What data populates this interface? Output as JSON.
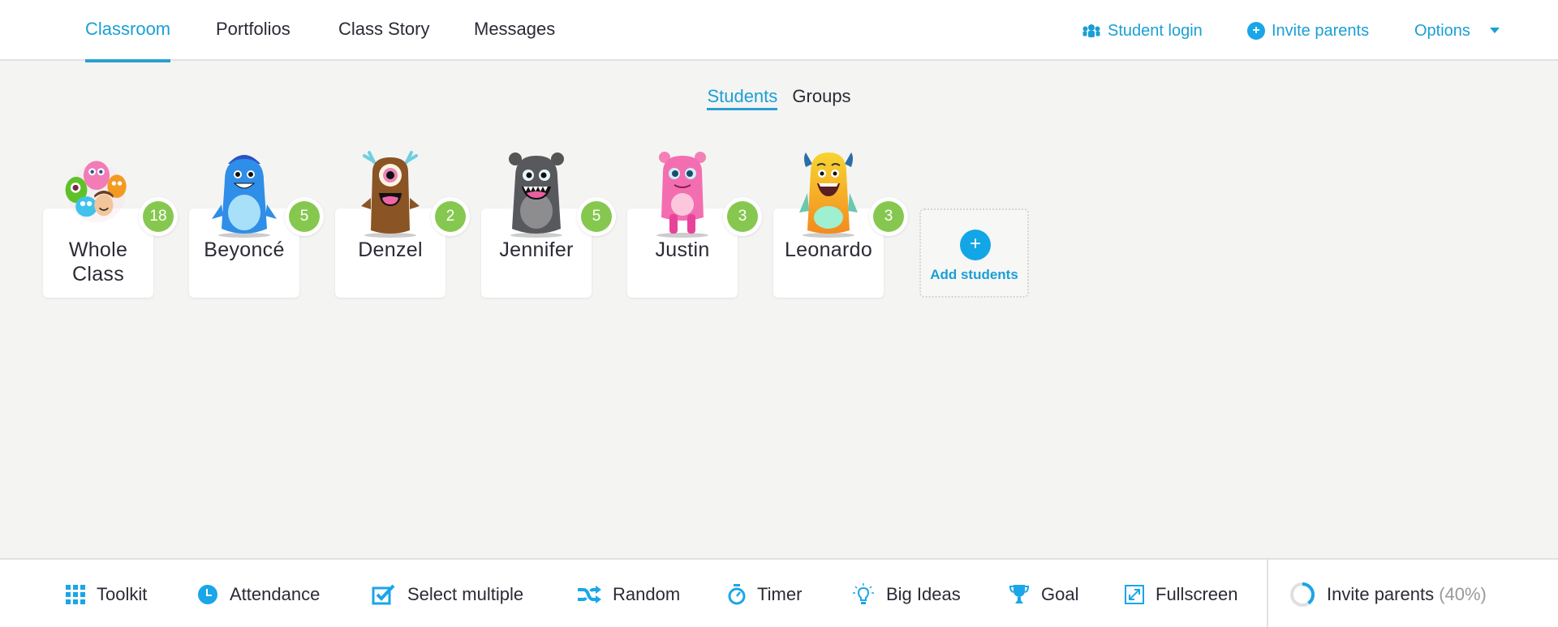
{
  "header": {
    "tabs": [
      {
        "label": "Classroom",
        "active": true
      },
      {
        "label": "Portfolios",
        "active": false
      },
      {
        "label": "Class Story",
        "active": false
      },
      {
        "label": "Messages",
        "active": false
      }
    ],
    "student_login": "Student login",
    "invite_parents": "Invite parents",
    "options": "Options"
  },
  "subtabs": {
    "students": "Students",
    "groups": "Groups",
    "active": "students"
  },
  "students": [
    {
      "name_line1": "Whole",
      "name_line2": "Class",
      "points": "18",
      "avatar": "whole-class-monsters"
    },
    {
      "name_line1": "Beyoncé",
      "points": "5",
      "avatar": "blue-monster"
    },
    {
      "name_line1": "Denzel",
      "points": "2",
      "avatar": "brown-cyclops-monster"
    },
    {
      "name_line1": "Jennifer",
      "points": "5",
      "avatar": "gray-monster"
    },
    {
      "name_line1": "Justin",
      "points": "3",
      "avatar": "pink-monster"
    },
    {
      "name_line1": "Leonardo",
      "points": "3",
      "avatar": "yellow-monster"
    }
  ],
  "add_students": {
    "icon": "+",
    "label": "Add students"
  },
  "toolbar": {
    "items": [
      {
        "label": "Toolkit",
        "icon": "grid-icon"
      },
      {
        "label": "Attendance",
        "icon": "clock-icon"
      },
      {
        "label": "Select multiple",
        "icon": "checkbox-icon"
      },
      {
        "label": "Random",
        "icon": "shuffle-icon"
      },
      {
        "label": "Timer",
        "icon": "stopwatch-icon"
      },
      {
        "label": "Big Ideas",
        "icon": "lightbulb-icon"
      },
      {
        "label": "Goal",
        "icon": "trophy-icon"
      },
      {
        "label": "Fullscreen",
        "icon": "fullscreen-icon"
      }
    ],
    "invite_parents": {
      "label": "Invite parents",
      "percent_text": "(40%)",
      "progress": 0.4
    }
  },
  "colors": {
    "accent": "#1aa0d6",
    "badge": "#86c84f",
    "background": "#f4f4f3"
  }
}
